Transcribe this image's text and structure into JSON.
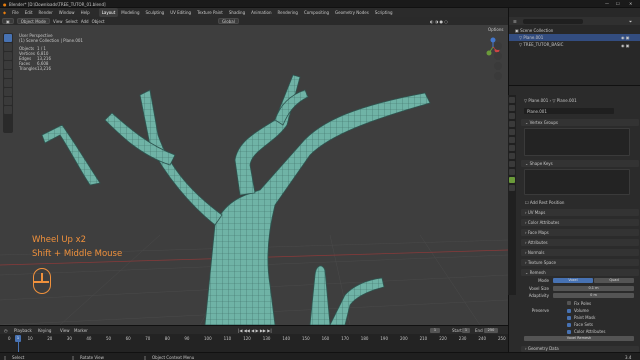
{
  "window": {
    "title": "Blender* [D:\\Downloads\\TREE_TUTOR_01.blend]"
  },
  "menu": {
    "items": [
      "File",
      "Edit",
      "Render",
      "Window",
      "Help"
    ],
    "workspaces": [
      "Layout",
      "Modeling",
      "Sculpting",
      "UV Editing",
      "Texture Paint",
      "Shading",
      "Animation",
      "Rendering",
      "Compositing",
      "Geometry Nodes",
      "Scripting"
    ],
    "scene": "Scene",
    "view_layer": "ViewLayer"
  },
  "viewport_header": {
    "mode": "Object Mode",
    "view": "View",
    "select": "Select",
    "add": "Add",
    "object": "Object",
    "orientation": "Global",
    "options": "Options"
  },
  "stats": {
    "view": "User Perspective",
    "collection": "(1) Scene Collection | Plane.001",
    "rows": [
      {
        "label": "Objects",
        "value": "1 / 1"
      },
      {
        "label": "Vertices",
        "value": "6,810"
      },
      {
        "label": "Edges",
        "value": "13,216"
      },
      {
        "label": "Faces",
        "value": "6,608"
      },
      {
        "label": "Triangles",
        "value": "13,216"
      }
    ]
  },
  "overlay": {
    "line1": "Wheel Up x2",
    "line2": "Shift + Middle Mouse"
  },
  "outliner": {
    "root": "Scene Collection",
    "items": [
      "Plane.001",
      "TREE_TUTOR_BASIC"
    ]
  },
  "properties": {
    "breadcrumb_left": "Plane.001",
    "breadcrumb_right": "Plane.001",
    "mesh_name": "Plane.001",
    "panels": [
      "Vertex Groups",
      "Shape Keys",
      "Add Rest Position",
      "UV Maps",
      "Color Attributes",
      "Face Maps",
      "Attributes",
      "Normals",
      "Texture Space",
      "Remesh"
    ],
    "remesh": {
      "mode_label": "Mode",
      "mode_voxel": "Voxel",
      "mode_quad": "Quad",
      "voxel_size_label": "Voxel Size",
      "voxel_size": "0.1 m",
      "adaptivity_label": "Adaptivity",
      "adaptivity": "0 m",
      "fix_poles": "Fix Poles",
      "preserve_label": "Preserve",
      "volume": "Volume",
      "paint_mask": "Paint Mask",
      "face_sets": "Face Sets",
      "color_attributes": "Color Attributes",
      "voxel_remesh_button": "Voxel Remesh"
    },
    "geometry_data": "Geometry Data"
  },
  "timeline": {
    "playback": "Playback",
    "keying": "Keying",
    "view": "View",
    "marker": "Marker",
    "current_frame": "1",
    "start_label": "Start",
    "start": "1",
    "end_label": "End",
    "end": "250",
    "ticks": [
      "0",
      "10",
      "20",
      "30",
      "40",
      "50",
      "60",
      "70",
      "80",
      "90",
      "100",
      "110",
      "120",
      "130",
      "140",
      "150",
      "160",
      "170",
      "180",
      "190",
      "200",
      "210",
      "220",
      "230",
      "240",
      "250"
    ]
  },
  "status": {
    "select": "Select",
    "rotate": "Rotate View",
    "context": "Object Context Menu",
    "version": "3.4"
  }
}
